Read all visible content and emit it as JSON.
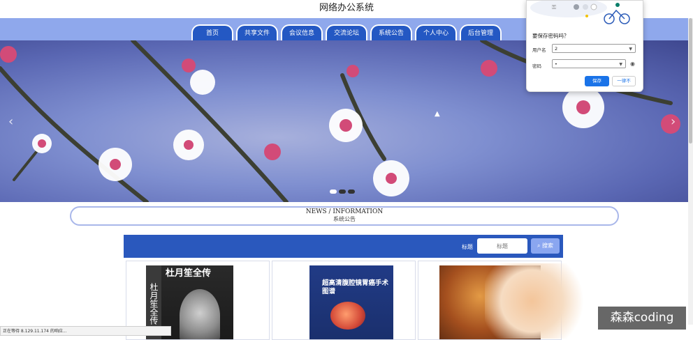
{
  "app": {
    "title": "网络办公系统"
  },
  "nav": {
    "items": [
      "首页",
      "共享文件",
      "会议信息",
      "交流论坛",
      "系统公告",
      "个人中心",
      "后台管理"
    ]
  },
  "banner": {
    "prev": "‹",
    "next": "›",
    "slide_count": 3,
    "active_slide": 1
  },
  "news": {
    "en": "NEWS / INFORMATION",
    "cn": "系统公告"
  },
  "search": {
    "label": "标题",
    "placeholder": "标题",
    "button": "搜索"
  },
  "cards": [
    {
      "title": "杜月笙全传",
      "side": "杜月笙全传"
    },
    {
      "title": "超高清腹腔镜胃癌手术图谱"
    },
    {
      "title": ""
    }
  ],
  "password_popup": {
    "title": "要保存密码吗？",
    "username_label": "用户名",
    "username_value": "2",
    "password_label": "密码",
    "password_value": "•",
    "save_button": "保存",
    "never_button": "一律不"
  },
  "status_bar": {
    "text": "正在等待 8.129.11.174 的响应..."
  },
  "watermark": {
    "text": "森森coding"
  },
  "colors": {
    "nav_blue": "#2458c3",
    "band": "#8fa8ec",
    "search_bar": "#2a58bd",
    "popup_save": "#1a73e8"
  }
}
